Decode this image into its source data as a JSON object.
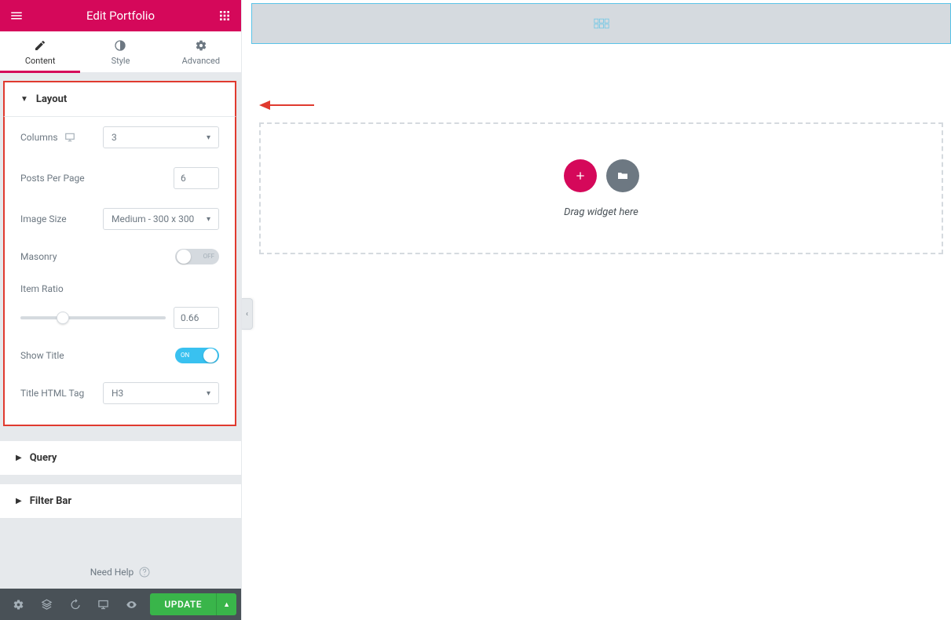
{
  "header": {
    "title": "Edit Portfolio"
  },
  "tabs": [
    {
      "label": "Content"
    },
    {
      "label": "Style"
    },
    {
      "label": "Advanced"
    }
  ],
  "sections": {
    "layout": {
      "title": "Layout",
      "columns_label": "Columns",
      "columns_value": "3",
      "posts_per_page_label": "Posts Per Page",
      "posts_per_page_value": "6",
      "image_size_label": "Image Size",
      "image_size_value": "Medium - 300 x 300",
      "masonry_label": "Masonry",
      "masonry_state": "OFF",
      "item_ratio_label": "Item Ratio",
      "item_ratio_value": "0.66",
      "show_title_label": "Show Title",
      "show_title_state": "ON",
      "title_tag_label": "Title HTML Tag",
      "title_tag_value": "H3"
    },
    "query": {
      "title": "Query"
    },
    "filter_bar": {
      "title": "Filter Bar"
    }
  },
  "need_help": "Need Help",
  "footer": {
    "update": "UPDATE"
  },
  "canvas": {
    "drag_hint": "Drag widget here"
  }
}
